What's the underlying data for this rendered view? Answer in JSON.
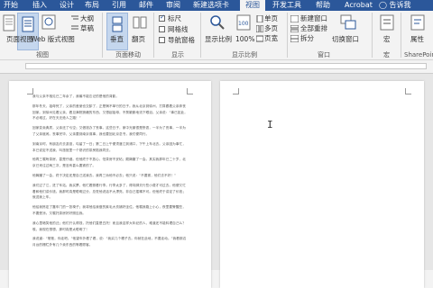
{
  "ribbon_tabs": [
    {
      "label": "开始",
      "active": false
    },
    {
      "label": "插入",
      "active": false
    },
    {
      "label": "设计",
      "active": false
    },
    {
      "label": "布局",
      "active": false
    },
    {
      "label": "引用",
      "active": false
    },
    {
      "label": "邮件",
      "active": false
    },
    {
      "label": "审阅",
      "active": false
    },
    {
      "label": "新建选项卡",
      "active": false
    },
    {
      "label": "视图",
      "active": true
    },
    {
      "label": "开发工具",
      "active": false
    },
    {
      "label": "帮助",
      "active": false
    },
    {
      "label": "Acrobat",
      "active": false
    },
    {
      "label": "告诉我",
      "active": false
    }
  ],
  "views_group": {
    "read_mode": "",
    "print_layout": "页面视图",
    "web_layout": "Web 版式视图",
    "outline": "大纲",
    "draft": "草稿",
    "label": "视图"
  },
  "page_movement_group": {
    "vertical": "垂直",
    "side_to_side": "翻页",
    "label": "页面移动"
  },
  "show_group": {
    "ruler": "标尺",
    "gridlines": "网格线",
    "nav_pane": "导航窗格",
    "ruler_checked": true,
    "gridlines_checked": false,
    "nav_pane_checked": false,
    "label": "显示"
  },
  "zoom_group": {
    "zoom": "显示比例",
    "hundred": "100%",
    "one_page": "单页",
    "multi_page": "多页",
    "page_width": "页宽",
    "label": "显示比例"
  },
  "window_group": {
    "new_window": "新建窗口",
    "arrange_all": "全部重排",
    "split": "拆分",
    "switch_windows": "切换窗口",
    "label": "窗口"
  },
  "macros_group": {
    "macros": "宏",
    "label": "宏"
  },
  "properties_group": {
    "properties": "属性",
    "label": "SharePoint"
  },
  "colors": {
    "accent": "#2b579a",
    "ribbon_bg": "#f3f3f3",
    "doc_bg": "#e6e6e6"
  },
  "document_paragraphs": [
    "我与父亲不相见已二年余了，我最不能忘记的是他的背影。",
    "那年冬天，祖母死了，父亲的差使也交卸了，正是祸不单行的日子。我从北京到徐州，打算跟着父亲奔丧回家。到徐州见着父亲，看见满院狼藉的东西，又想起祖母，不禁簌簌地流下眼泪。父亲说：“事已如此，不必难过，好在天无绝人之路！”",
    "回家变卖典质，父亲还了亏空；又借钱办了丧事。这些日子，家中光景很是惨澹，一半为了丧事，一半为了父亲赋闲。丧事完毕，父亲要到南京谋事，我也要回北京念书，我们便同行。",
    "到南京时，有朋友约去游逛，勾留了一日；第二日上午便须渡江到浦口，下午上车北去。父亲因为事忙，本已说定不送我，叫旅馆里一个熟识的茶房陪我同去。",
    "他再三嘱咐茶房，甚是仔细。但他终于不放心，怕茶房不妥帖；颇踌躇了一会。其实我那年已二十岁，北京已来往过两三次，是没有甚么要紧的了。",
    "他踌躇了一会，终于决定还是自己送我去。我再三劝他不必去；他只说：“不要紧，他们去不好！”",
    "我们过了江，进了车站。我买票，他忙着照看行李。行李太多了，得向脚夫行些小费才可过去。他便又忙着和他们讲价钱。我那时真是聪明过分，总觉他说话不大漂亮，非自己插嘴不可。但他终于讲定了价钱；就送我上车。",
    "他给我拣定了靠车门的一张椅子；我将他给我做的紫毛大衣铺好坐位。他嘱我路上小心，夜里要警醒些，不要受凉。又嘱托茶房好好照应我。",
    "我心里暗笑他的迂；他们只认得钱，托他们直是白托！而且我这样大年纪的人，难道还不能料理自己么？唉，我现在想想，那时真是太聪明了！",
    "我说道：“爸爸，你走吧。”他望车外看了看，说：“我买几个橘子去。你就在此地，不要走动。”我看那边月台的栅栏外有几个卖东西的等着顾客。"
  ]
}
